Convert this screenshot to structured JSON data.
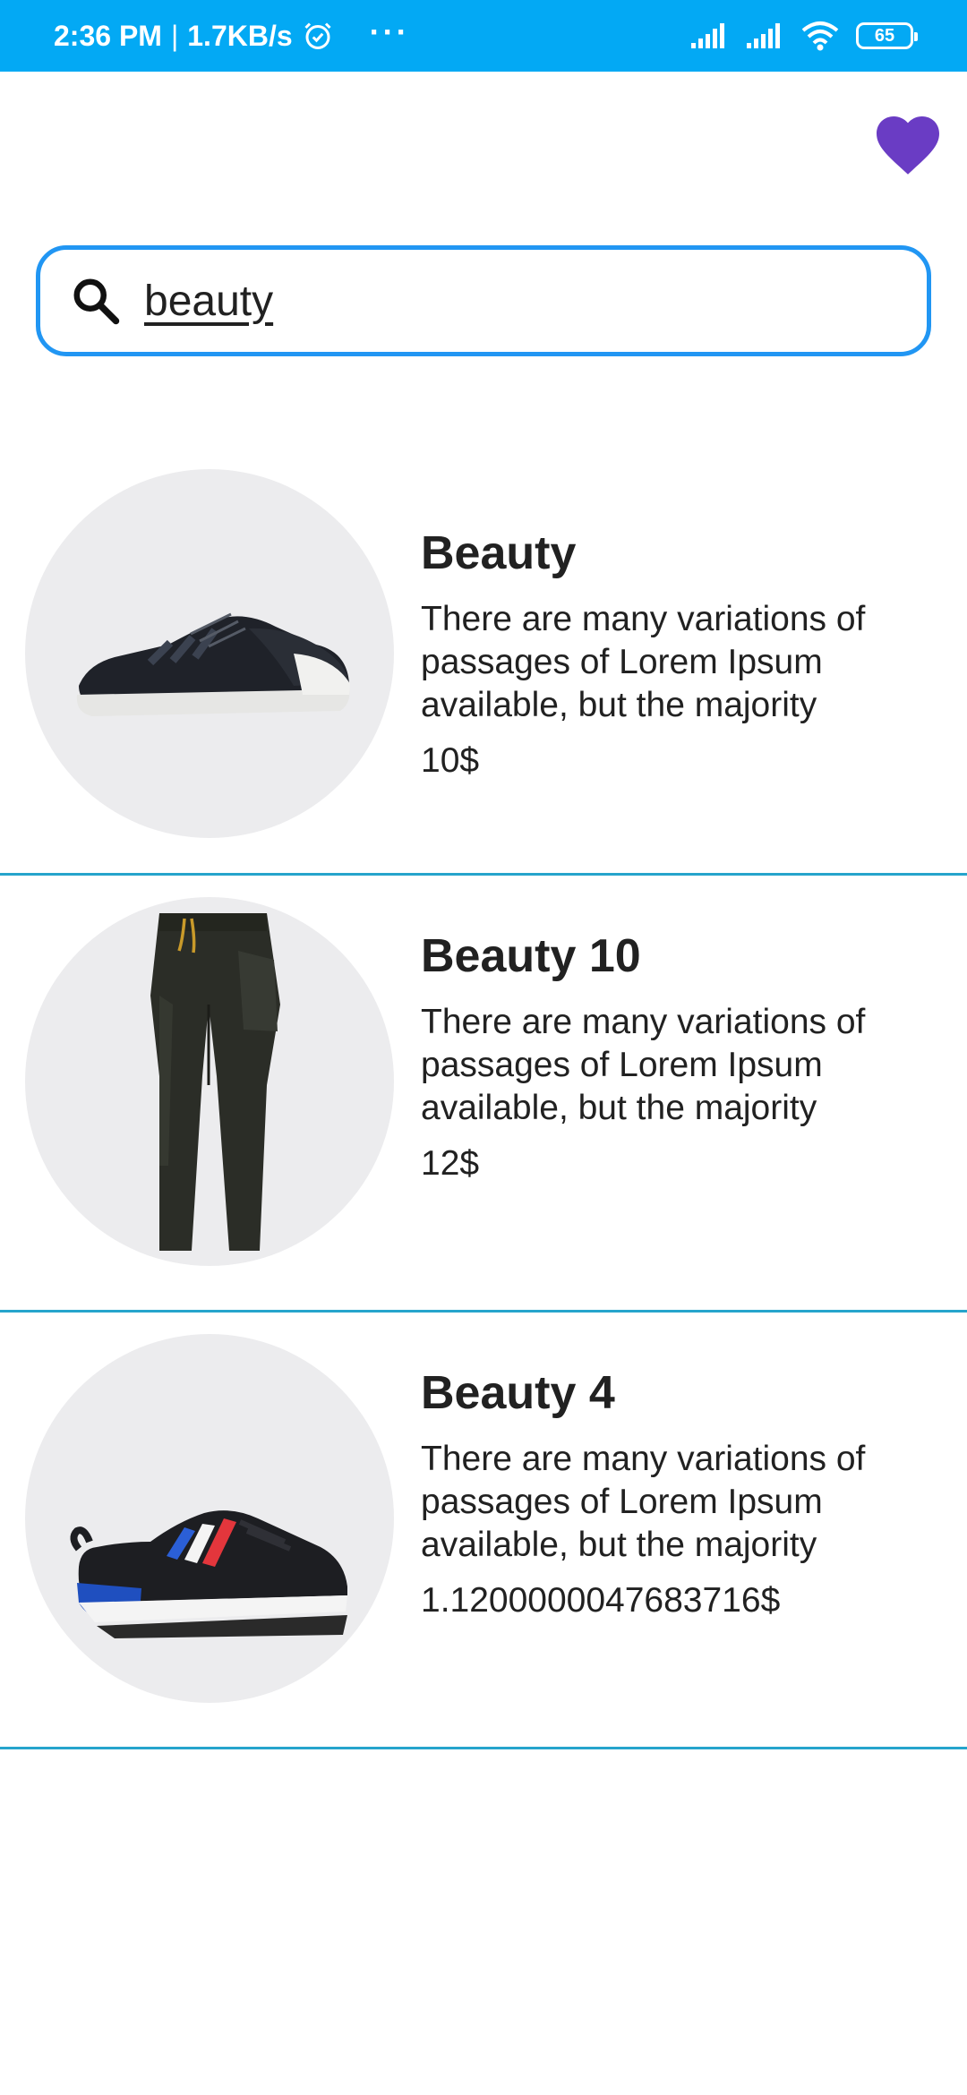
{
  "status_bar": {
    "time": "2:36 PM",
    "separator": "|",
    "speed": "1.7KB/s",
    "more": "···",
    "battery": "65"
  },
  "favorites": {
    "icon": "heart-icon",
    "color": "#6a3cc4"
  },
  "search": {
    "icon": "search-icon",
    "value": "beauty"
  },
  "products": [
    {
      "title": "Beauty",
      "description": "There are many variations of passages of Lorem Ipsum available, but the majority",
      "price": "10$",
      "image": "black-sneaker"
    },
    {
      "title": "Beauty 10",
      "description": "There are many variations of passages of Lorem Ipsum available, but the majority",
      "price": "12$",
      "image": "black-pants"
    },
    {
      "title": "Beauty 4",
      "description": "There are many variations of passages of Lorem Ipsum available, but the majority",
      "price": "1.1200000047683716$",
      "image": "striped-sneaker"
    }
  ],
  "colors": {
    "status_bar": "#03a9f4",
    "search_border": "#2196f3",
    "divider": "#26a4cc"
  }
}
